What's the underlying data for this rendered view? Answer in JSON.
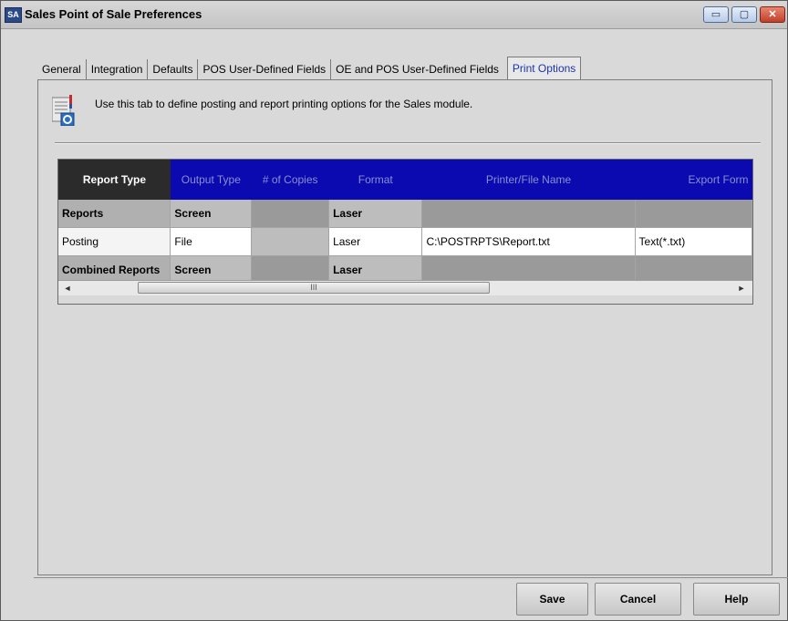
{
  "window": {
    "icon_text": "SA",
    "title": "Sales Point of Sale Preferences",
    "minimize": "▭",
    "maximize": "▢",
    "close": "✕"
  },
  "tabs": [
    {
      "label": "General"
    },
    {
      "label": "Integration"
    },
    {
      "label": "Defaults"
    },
    {
      "label": "POS User-Defined Fields"
    },
    {
      "label": "OE and POS User-Defined Fields"
    },
    {
      "label": "Print Options",
      "active": true
    }
  ],
  "info": {
    "icon": "document-settings-icon",
    "text": "Use this tab to define posting and report printing options for the Sales module."
  },
  "grid": {
    "columns": [
      "Report Type",
      "Output Type",
      "# of Copies",
      "Format",
      "Printer/File Name",
      "Export Form"
    ],
    "rows": [
      {
        "type": "Reports",
        "output": "Screen",
        "copies": "",
        "format": "Laser",
        "printer": "",
        "export": ""
      },
      {
        "type": "Posting",
        "output": "File",
        "copies": "",
        "format": "Laser",
        "printer": "C:\\POSTRPTS\\Report.txt",
        "export": "Text(*.txt)"
      },
      {
        "type": "Combined Reports",
        "output": "Screen",
        "copies": "",
        "format": "Laser",
        "printer": "",
        "export": ""
      }
    ],
    "scroll_left": "◄",
    "scroll_right": "►",
    "scroll_grip": "III"
  },
  "buttons": {
    "save": "Save",
    "cancel": "Cancel",
    "help": "Help"
  },
  "colors": {
    "header_blue": "#0a0ab0",
    "active_tab_text": "#1a35a8"
  }
}
